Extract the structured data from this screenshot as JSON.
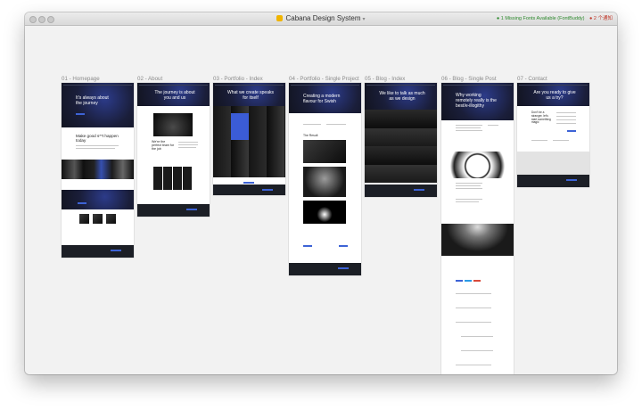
{
  "window": {
    "title": "Cabana Design System",
    "missing_fonts_note": "1 Missing Fonts Available (FontBuddy)",
    "notification_count": "2 个通知"
  },
  "artboards": [
    {
      "label": "01 - Homepage",
      "hero": "It's always about the journey",
      "headline": "Make good s**t happen today"
    },
    {
      "label": "02 - About",
      "hero": "The journey is about you and us",
      "headline": "We're the perfect team for the job"
    },
    {
      "label": "03 - Portfolio - Index",
      "hero": "What we create speaks for itself"
    },
    {
      "label": "04 - Portfolio - Single Project",
      "hero": "Creating a modern flavour for Swish",
      "section": "The Result"
    },
    {
      "label": "05 - Blog - Index",
      "hero": "We like to talk as much as we design"
    },
    {
      "label": "06 - Blog - Single Post",
      "hero": "Why working remotely really is the best/e-illogithy"
    },
    {
      "label": "07 - Contact",
      "hero": "Are you ready to give us a try?",
      "headline": "Don't be a stranger, let's start something magic"
    }
  ]
}
